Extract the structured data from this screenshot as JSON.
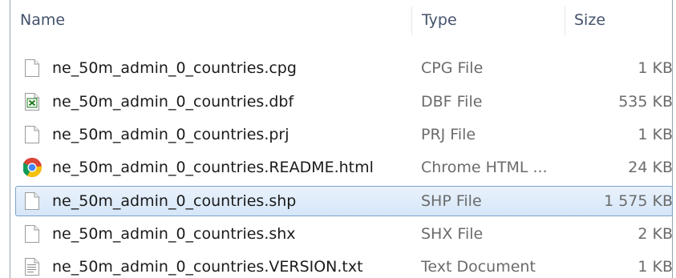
{
  "header": {
    "name_label": "Name",
    "type_label": "Type",
    "size_label": "Size"
  },
  "files": [
    {
      "name": "ne_50m_admin_0_countries.cpg",
      "type": "CPG File",
      "size": "1 KB",
      "icon": "blank-file-icon",
      "selected": false
    },
    {
      "name": "ne_50m_admin_0_countries.dbf",
      "type": "DBF File",
      "size": "535 KB",
      "icon": "excel-file-icon",
      "selected": false
    },
    {
      "name": "ne_50m_admin_0_countries.prj",
      "type": "PRJ File",
      "size": "1 KB",
      "icon": "blank-file-icon",
      "selected": false
    },
    {
      "name": "ne_50m_admin_0_countries.README.html",
      "type": "Chrome HTML ...",
      "size": "24 KB",
      "icon": "chrome-icon",
      "selected": false
    },
    {
      "name": "ne_50m_admin_0_countries.shp",
      "type": "SHP File",
      "size": "1 575 KB",
      "icon": "blank-file-icon",
      "selected": true
    },
    {
      "name": "ne_50m_admin_0_countries.shx",
      "type": "SHX File",
      "size": "2 KB",
      "icon": "blank-file-icon",
      "selected": false
    },
    {
      "name": "ne_50m_admin_0_countries.VERSION.txt",
      "type": "Text Document",
      "size": "1 KB",
      "icon": "text-file-icon",
      "selected": false
    }
  ],
  "colors": {
    "selection_fill": "#dbe8f8",
    "selection_border": "#7da2ce",
    "header_text": "#44526b",
    "secondary_text": "#6b6b6b"
  }
}
